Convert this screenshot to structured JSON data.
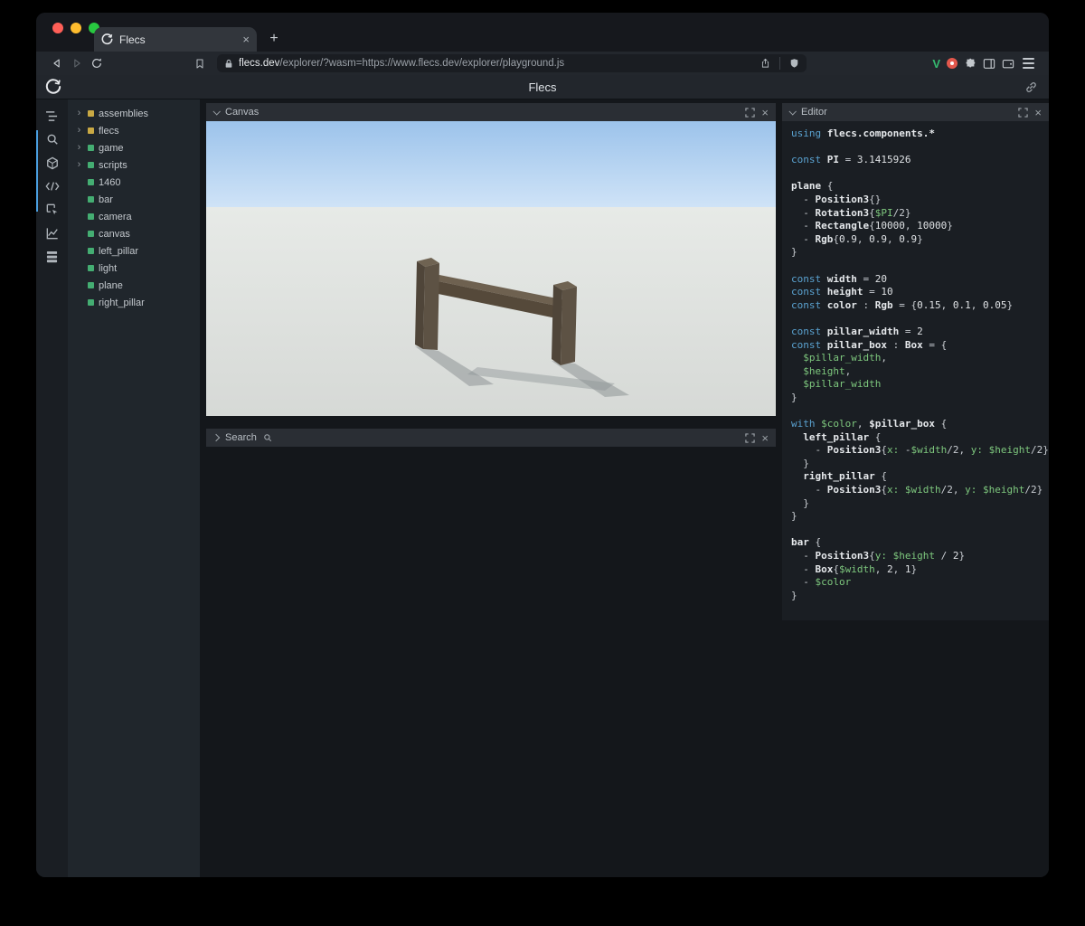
{
  "browser": {
    "tab_title": "Flecs",
    "new_tab_label": "+",
    "url_domain": "flecs.dev",
    "url_rest": "/explorer/?wasm=https://www.flecs.dev/explorer/playground.js"
  },
  "header": {
    "title": "Flecs"
  },
  "panels": {
    "canvas_title": "Canvas",
    "search_title": "Search",
    "editor_title": "Editor"
  },
  "tree": {
    "items": [
      {
        "label": "assemblies",
        "dot": "#c9a944",
        "arrow": true
      },
      {
        "label": "flecs",
        "dot": "#c9a944",
        "arrow": true
      },
      {
        "label": "game",
        "dot": "#44ad72",
        "arrow": true
      },
      {
        "label": "scripts",
        "dot": "#44ad72",
        "arrow": true
      },
      {
        "label": "1460",
        "dot": "#44ad72",
        "arrow": false
      },
      {
        "label": "bar",
        "dot": "#44ad72",
        "arrow": false
      },
      {
        "label": "camera",
        "dot": "#44ad72",
        "arrow": false
      },
      {
        "label": "canvas",
        "dot": "#44ad72",
        "arrow": false
      },
      {
        "label": "left_pillar",
        "dot": "#44ad72",
        "arrow": false
      },
      {
        "label": "light",
        "dot": "#44ad72",
        "arrow": false
      },
      {
        "label": "plane",
        "dot": "#44ad72",
        "arrow": false
      },
      {
        "label": "right_pillar",
        "dot": "#44ad72",
        "arrow": false
      }
    ]
  },
  "editor": {
    "lines": [
      [
        [
          "kw",
          "using "
        ],
        [
          "id",
          "flecs.components.*"
        ]
      ],
      [],
      [
        [
          "kw",
          "const "
        ],
        [
          "id",
          "PI"
        ],
        [
          "pl",
          " = "
        ],
        [
          "num",
          "3.1415926"
        ]
      ],
      [],
      [
        [
          "id",
          "plane"
        ],
        [
          "pl",
          " {"
        ]
      ],
      [
        [
          "pl",
          "  - "
        ],
        [
          "id",
          "Position3"
        ],
        [
          "pl",
          "{}"
        ]
      ],
      [
        [
          "pl",
          "  - "
        ],
        [
          "id",
          "Rotation3"
        ],
        [
          "pl",
          "{"
        ],
        [
          "var",
          "$PI"
        ],
        [
          "pl",
          "/2}"
        ]
      ],
      [
        [
          "pl",
          "  - "
        ],
        [
          "id",
          "Rectangle"
        ],
        [
          "pl",
          "{"
        ],
        [
          "num",
          "10000"
        ],
        [
          "pl",
          ", "
        ],
        [
          "num",
          "10000"
        ],
        [
          "pl",
          "}"
        ]
      ],
      [
        [
          "pl",
          "  - "
        ],
        [
          "id",
          "Rgb"
        ],
        [
          "pl",
          "{"
        ],
        [
          "num",
          "0.9"
        ],
        [
          "pl",
          ", "
        ],
        [
          "num",
          "0.9"
        ],
        [
          "pl",
          ", "
        ],
        [
          "num",
          "0.9"
        ],
        [
          "pl",
          "}"
        ]
      ],
      [
        [
          "pl",
          "}"
        ]
      ],
      [],
      [
        [
          "kw",
          "const "
        ],
        [
          "id",
          "width"
        ],
        [
          "pl",
          " = "
        ],
        [
          "num",
          "20"
        ]
      ],
      [
        [
          "kw",
          "const "
        ],
        [
          "id",
          "height"
        ],
        [
          "pl",
          " = "
        ],
        [
          "num",
          "10"
        ]
      ],
      [
        [
          "kw",
          "const "
        ],
        [
          "id",
          "color"
        ],
        [
          "pl",
          " : "
        ],
        [
          "id",
          "Rgb"
        ],
        [
          "pl",
          " = {"
        ],
        [
          "num",
          "0.15"
        ],
        [
          "pl",
          ", "
        ],
        [
          "num",
          "0.1"
        ],
        [
          "pl",
          ", "
        ],
        [
          "num",
          "0.05"
        ],
        [
          "pl",
          "}"
        ]
      ],
      [],
      [
        [
          "kw",
          "const "
        ],
        [
          "id",
          "pillar_width"
        ],
        [
          "pl",
          " = "
        ],
        [
          "num",
          "2"
        ]
      ],
      [
        [
          "kw",
          "const "
        ],
        [
          "id",
          "pillar_box"
        ],
        [
          "pl",
          " : "
        ],
        [
          "id",
          "Box"
        ],
        [
          "pl",
          " = {"
        ]
      ],
      [
        [
          "var",
          "  $pillar_width"
        ],
        [
          "pl",
          ","
        ]
      ],
      [
        [
          "var",
          "  $height"
        ],
        [
          "pl",
          ","
        ]
      ],
      [
        [
          "var",
          "  $pillar_width"
        ]
      ],
      [
        [
          "pl",
          "}"
        ]
      ],
      [],
      [
        [
          "kw",
          "with "
        ],
        [
          "var",
          "$color"
        ],
        [
          "pl",
          ", "
        ],
        [
          "id",
          "$pillar_box"
        ],
        [
          "pl",
          " {"
        ]
      ],
      [
        [
          "id",
          "  left_pillar"
        ],
        [
          "pl",
          " {"
        ]
      ],
      [
        [
          "pl",
          "    - "
        ],
        [
          "id",
          "Position3"
        ],
        [
          "pl",
          "{"
        ],
        [
          "var",
          "x:"
        ],
        [
          "pl",
          " -"
        ],
        [
          "var",
          "$width"
        ],
        [
          "pl",
          "/2, "
        ],
        [
          "var",
          "y:"
        ],
        [
          "pl",
          " "
        ],
        [
          "var",
          "$height"
        ],
        [
          "pl",
          "/2}"
        ]
      ],
      [
        [
          "pl",
          "  }"
        ]
      ],
      [
        [
          "id",
          "  right_pillar"
        ],
        [
          "pl",
          " {"
        ]
      ],
      [
        [
          "pl",
          "    - "
        ],
        [
          "id",
          "Position3"
        ],
        [
          "pl",
          "{"
        ],
        [
          "var",
          "x:"
        ],
        [
          "pl",
          " "
        ],
        [
          "var",
          "$width"
        ],
        [
          "pl",
          "/2, "
        ],
        [
          "var",
          "y:"
        ],
        [
          "pl",
          " "
        ],
        [
          "var",
          "$height"
        ],
        [
          "pl",
          "/2}"
        ]
      ],
      [
        [
          "pl",
          "  }"
        ]
      ],
      [
        [
          "pl",
          "}"
        ]
      ],
      [],
      [
        [
          "id",
          "bar"
        ],
        [
          "pl",
          " {"
        ]
      ],
      [
        [
          "pl",
          "  - "
        ],
        [
          "id",
          "Position3"
        ],
        [
          "pl",
          "{"
        ],
        [
          "var",
          "y:"
        ],
        [
          "pl",
          " "
        ],
        [
          "var",
          "$height"
        ],
        [
          "pl",
          " / "
        ],
        [
          "num",
          "2"
        ],
        [
          "pl",
          "}"
        ]
      ],
      [
        [
          "pl",
          "  - "
        ],
        [
          "id",
          "Box"
        ],
        [
          "pl",
          "{"
        ],
        [
          "var",
          "$width"
        ],
        [
          "pl",
          ", "
        ],
        [
          "num",
          "2"
        ],
        [
          "pl",
          ", "
        ],
        [
          "num",
          "1"
        ],
        [
          "pl",
          "}"
        ]
      ],
      [
        [
          "pl",
          "  - "
        ],
        [
          "var",
          "$color"
        ]
      ],
      [
        [
          "pl",
          "}"
        ]
      ]
    ]
  },
  "colors": {
    "accent_blue": "#4a9fe0",
    "entity_green": "#44ad72",
    "entity_yellow": "#c9a944",
    "syntax_keyword": "#5aa2d0",
    "syntax_identifier": "#e6e9ec",
    "syntax_variable": "#7ec87e",
    "sky_top": "#9cc3eb",
    "sky_horizon": "#cfe3f7",
    "ground": "#dde0dd",
    "wood_dark": "#4f4539",
    "wood_mid": "#5d5244",
    "wood_light": "#6f6352"
  }
}
